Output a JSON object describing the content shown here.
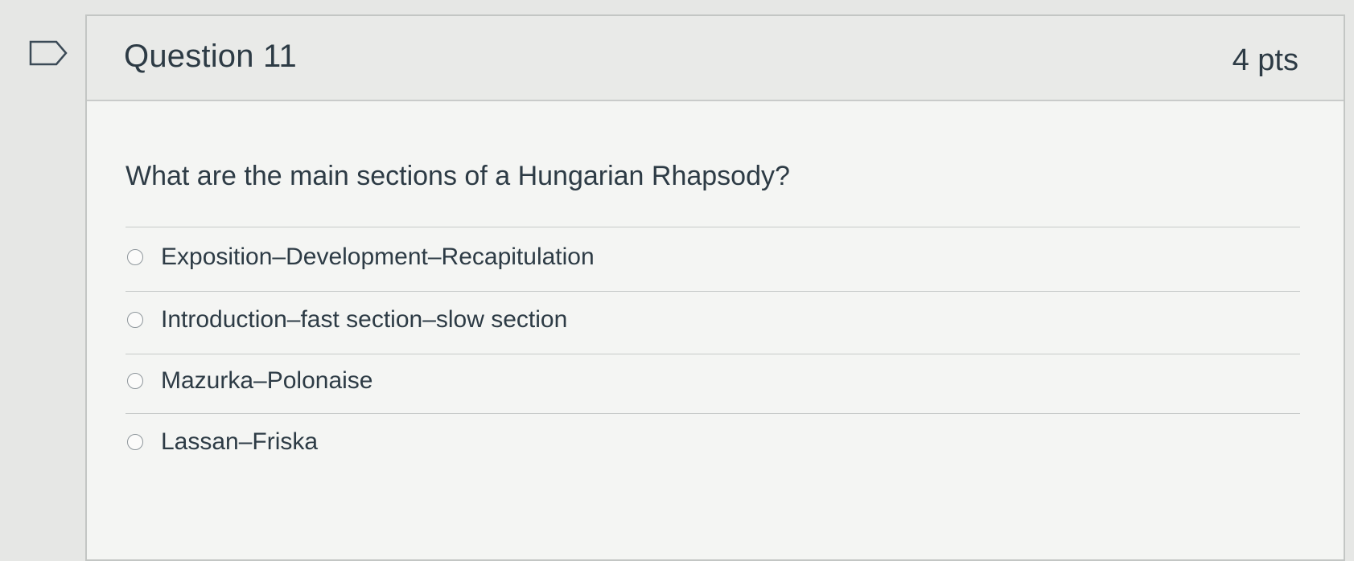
{
  "question": {
    "title": "Question 11",
    "points": "4 pts",
    "text": "What are the main sections of a Hungarian Rhapsody?",
    "flag_icon": "flag-icon"
  },
  "answers": [
    {
      "label": "Exposition–Development–Recapitulation",
      "selected": false
    },
    {
      "label": "Introduction–fast section–slow section",
      "selected": false
    },
    {
      "label": "Mazurka–Polonaise",
      "selected": false
    },
    {
      "label": "Lassan–Friska",
      "selected": false
    }
  ]
}
